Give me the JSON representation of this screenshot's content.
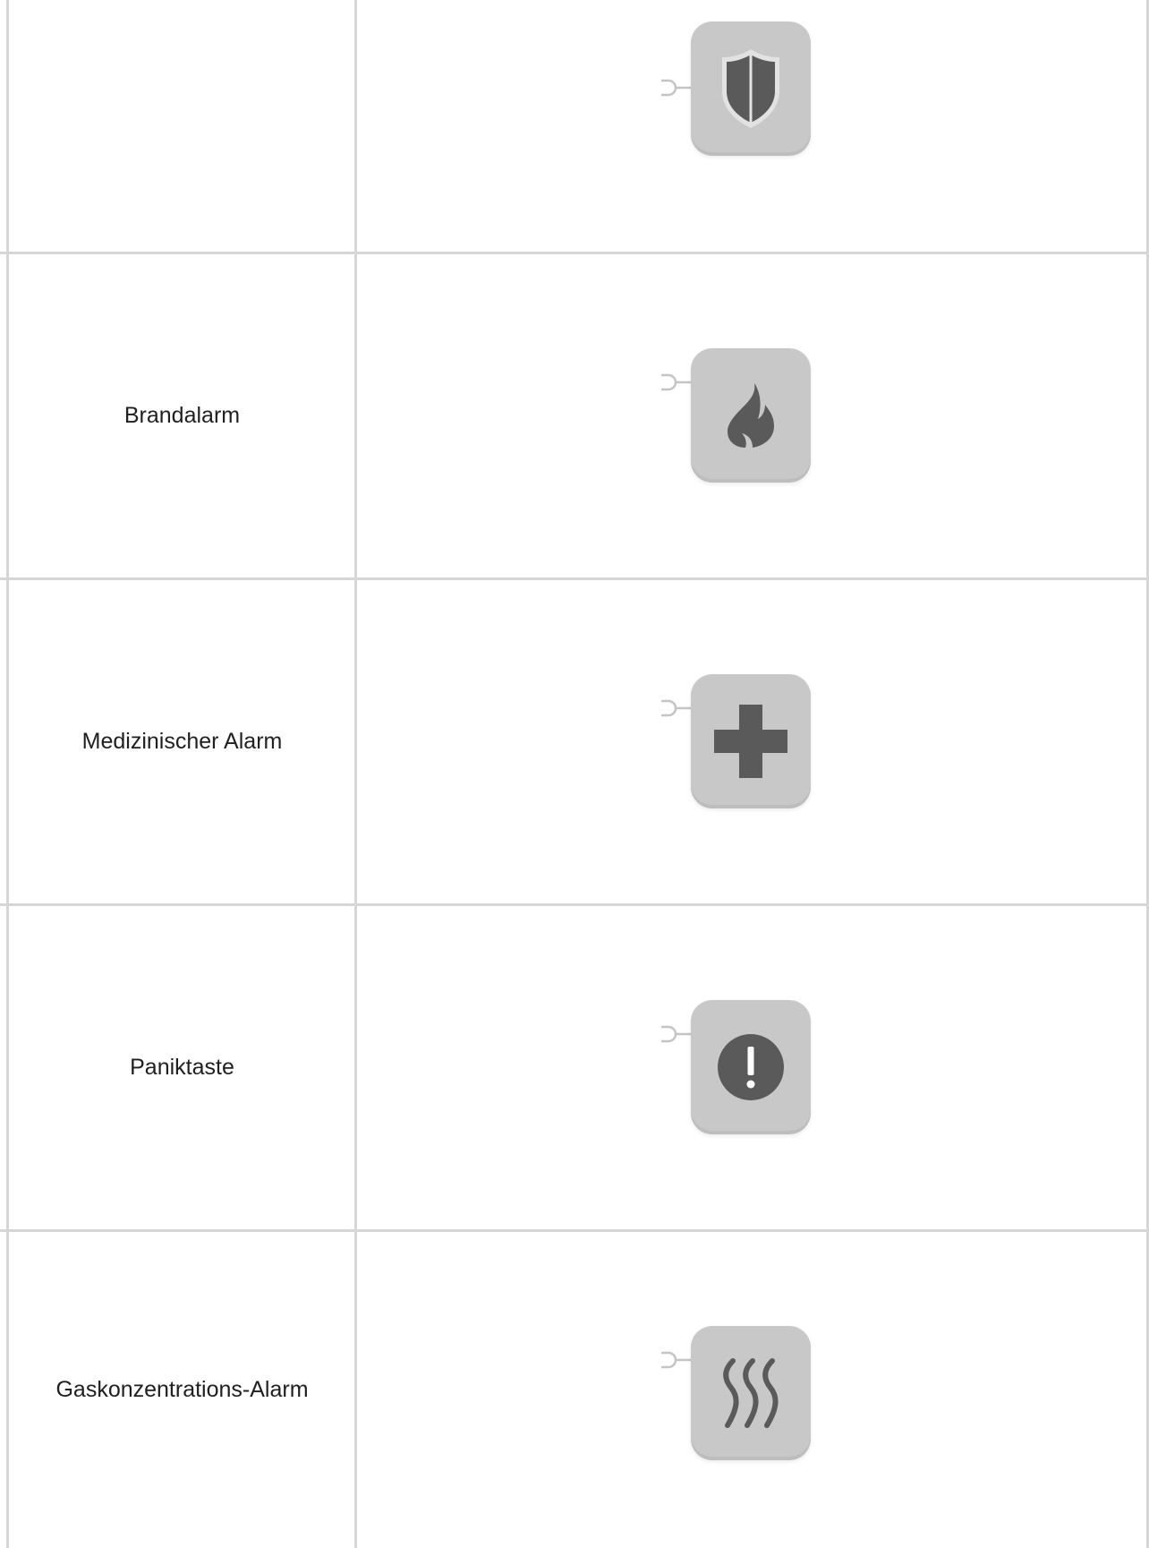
{
  "rows": [
    {
      "label": "",
      "icon": "shield-icon"
    },
    {
      "label": "Brandalarm",
      "icon": "flame-icon"
    },
    {
      "label": "Medizinischer Alarm",
      "icon": "medical-cross-icon"
    },
    {
      "label": "Paniktaste",
      "icon": "exclamation-circle-icon"
    },
    {
      "label": "Gaskonzentrations-Alarm",
      "icon": "gas-waves-icon"
    }
  ],
  "colors": {
    "grid_line": "#d6d6d6",
    "tile": "#c8c8c8",
    "icon": "#5a5a5a",
    "connector": "#c4c4c4"
  }
}
